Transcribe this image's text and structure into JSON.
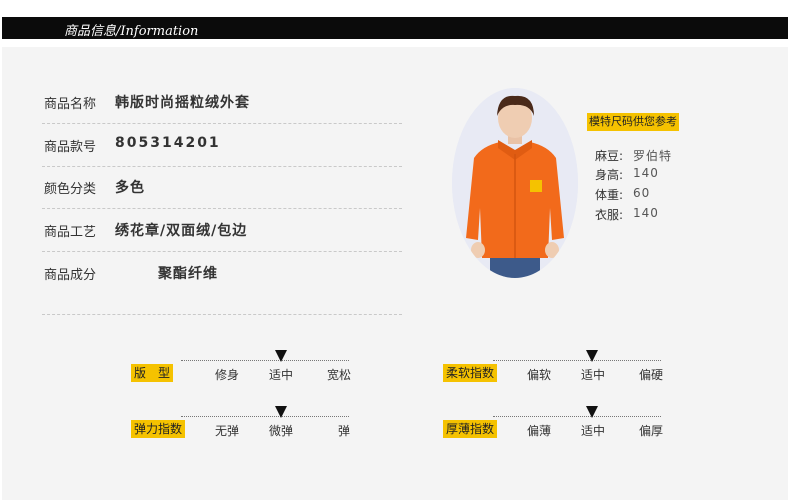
{
  "header": {
    "title": "商品信息/Information"
  },
  "info": [
    {
      "label": "商品名称",
      "value": "韩版时尚摇粒绒外套"
    },
    {
      "label": "商品款号",
      "value": "805314201"
    },
    {
      "label": "颜色分类",
      "value": "多色"
    },
    {
      "label": "商品工艺",
      "value": "绣花章/双面绒/包边"
    },
    {
      "label": "商品成分",
      "value": "聚酯纤维"
    }
  ],
  "model": {
    "tag": "模特尺码供您参考",
    "specs": [
      {
        "label": "麻豆:",
        "value": "罗伯特"
      },
      {
        "label": "身高:",
        "value": "140"
      },
      {
        "label": "体重:",
        "value": "60"
      },
      {
        "label": "衣服:",
        "value": "140"
      }
    ]
  },
  "scales": [
    {
      "label": "版　型",
      "options": [
        "修身",
        "适中",
        "宽松"
      ],
      "selected": "适中"
    },
    {
      "label": "柔软指数",
      "options": [
        "偏软",
        "适中",
        "偏硬"
      ],
      "selected": "适中"
    },
    {
      "label": "弹力指数",
      "options": [
        "无弹",
        "微弹",
        "弹"
      ],
      "selected": "微弹"
    },
    {
      "label": "厚薄指数",
      "options": [
        "偏薄",
        "适中",
        "偏厚"
      ],
      "selected": "适中"
    }
  ],
  "colors": {
    "accent": "#f5c200",
    "header": "#0b0b0b",
    "jacket": "#f26a1b"
  }
}
